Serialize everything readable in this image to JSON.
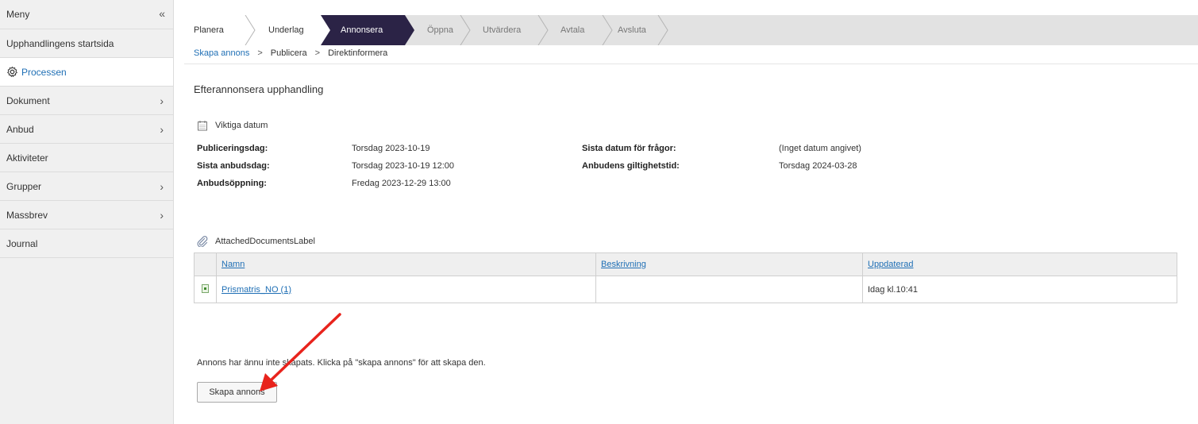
{
  "sidebar": {
    "menu_label": "Meny",
    "collapse_glyph": "«",
    "items": [
      {
        "label": "Upphandlingens startsida",
        "has_children": false
      },
      {
        "label": "Processen",
        "has_children": false,
        "active": true,
        "icon": "gear-icon"
      },
      {
        "label": "Dokument",
        "has_children": true
      },
      {
        "label": "Anbud",
        "has_children": true
      },
      {
        "label": "Aktiviteter",
        "has_children": false
      },
      {
        "label": "Grupper",
        "has_children": true
      },
      {
        "label": "Massbrev",
        "has_children": true
      },
      {
        "label": "Journal",
        "has_children": false
      }
    ]
  },
  "process_steps": {
    "steps": [
      {
        "label": "Planera",
        "state": "done"
      },
      {
        "label": "Underlag",
        "state": "done"
      },
      {
        "label": "Annonsera",
        "state": "active"
      },
      {
        "label": "Öppna",
        "state": "future"
      },
      {
        "label": "Utvärdera",
        "state": "future"
      },
      {
        "label": "Avtala",
        "state": "future"
      },
      {
        "label": "Avsluta",
        "state": "future"
      }
    ],
    "active_color": "#2b2346"
  },
  "sub_steps": {
    "items": [
      "Skapa annons",
      "Publicera",
      "Direktinformera"
    ],
    "separator": ">"
  },
  "page": {
    "title": "Efterannonsera upphandling"
  },
  "important_dates": {
    "heading": "Viktiga datum",
    "left": [
      {
        "label": "Publiceringsdag:",
        "value": "Torsdag 2023-10-19"
      },
      {
        "label": "Sista anbudsdag:",
        "value": "Torsdag 2023-10-19 12:00"
      },
      {
        "label": "Anbudsöppning:",
        "value": "Fredag 2023-12-29 13:00"
      }
    ],
    "right": [
      {
        "label": "Sista datum för frågor:",
        "value": "(Inget datum angivet)"
      },
      {
        "label": "Anbudens giltighetstid:",
        "value": "Torsdag 2024-03-28"
      }
    ]
  },
  "attached_documents": {
    "heading": "AttachedDocumentsLabel",
    "columns": [
      "Namn",
      "Beskrivning",
      "Uppdaterad"
    ],
    "rows": [
      {
        "name": "Prismatris_NO (1)",
        "description": "",
        "updated": "Idag kl.10:41",
        "icon": "excel-file-icon"
      }
    ]
  },
  "notice": {
    "text": "Annons har ännu inte skapats. Klicka på \"skapa annons\" för att skapa den.",
    "button_label": "Skapa annons"
  },
  "annotation": {
    "color": "#e8231c"
  }
}
